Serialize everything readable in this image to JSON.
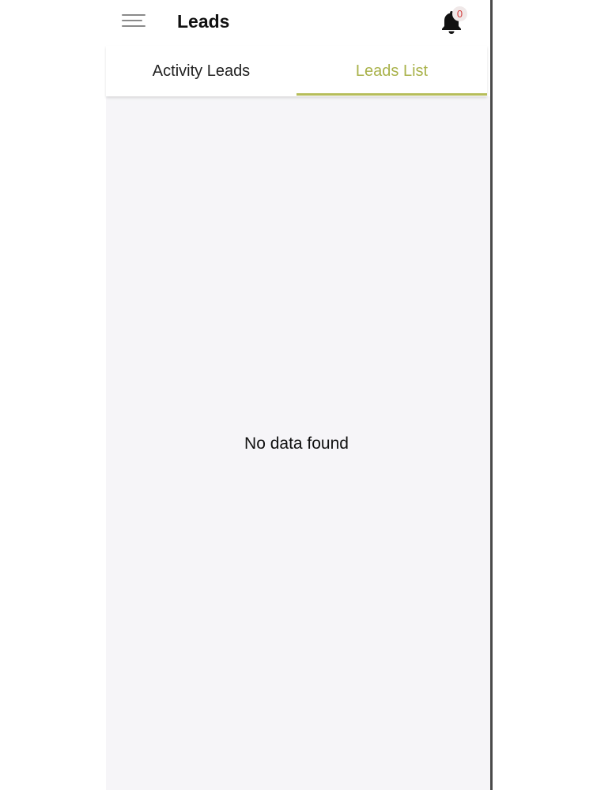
{
  "header": {
    "title": "Leads",
    "menu_icon": "hamburger-menu-icon",
    "notification_icon": "bell-icon",
    "notification_count": "0",
    "badge_color": "#d33a3a"
  },
  "tabs": [
    {
      "label": "Activity Leads",
      "active": false
    },
    {
      "label": "Leads List",
      "active": true
    }
  ],
  "accent_color": "#a9b24a",
  "content": {
    "empty_message": "No data found"
  }
}
